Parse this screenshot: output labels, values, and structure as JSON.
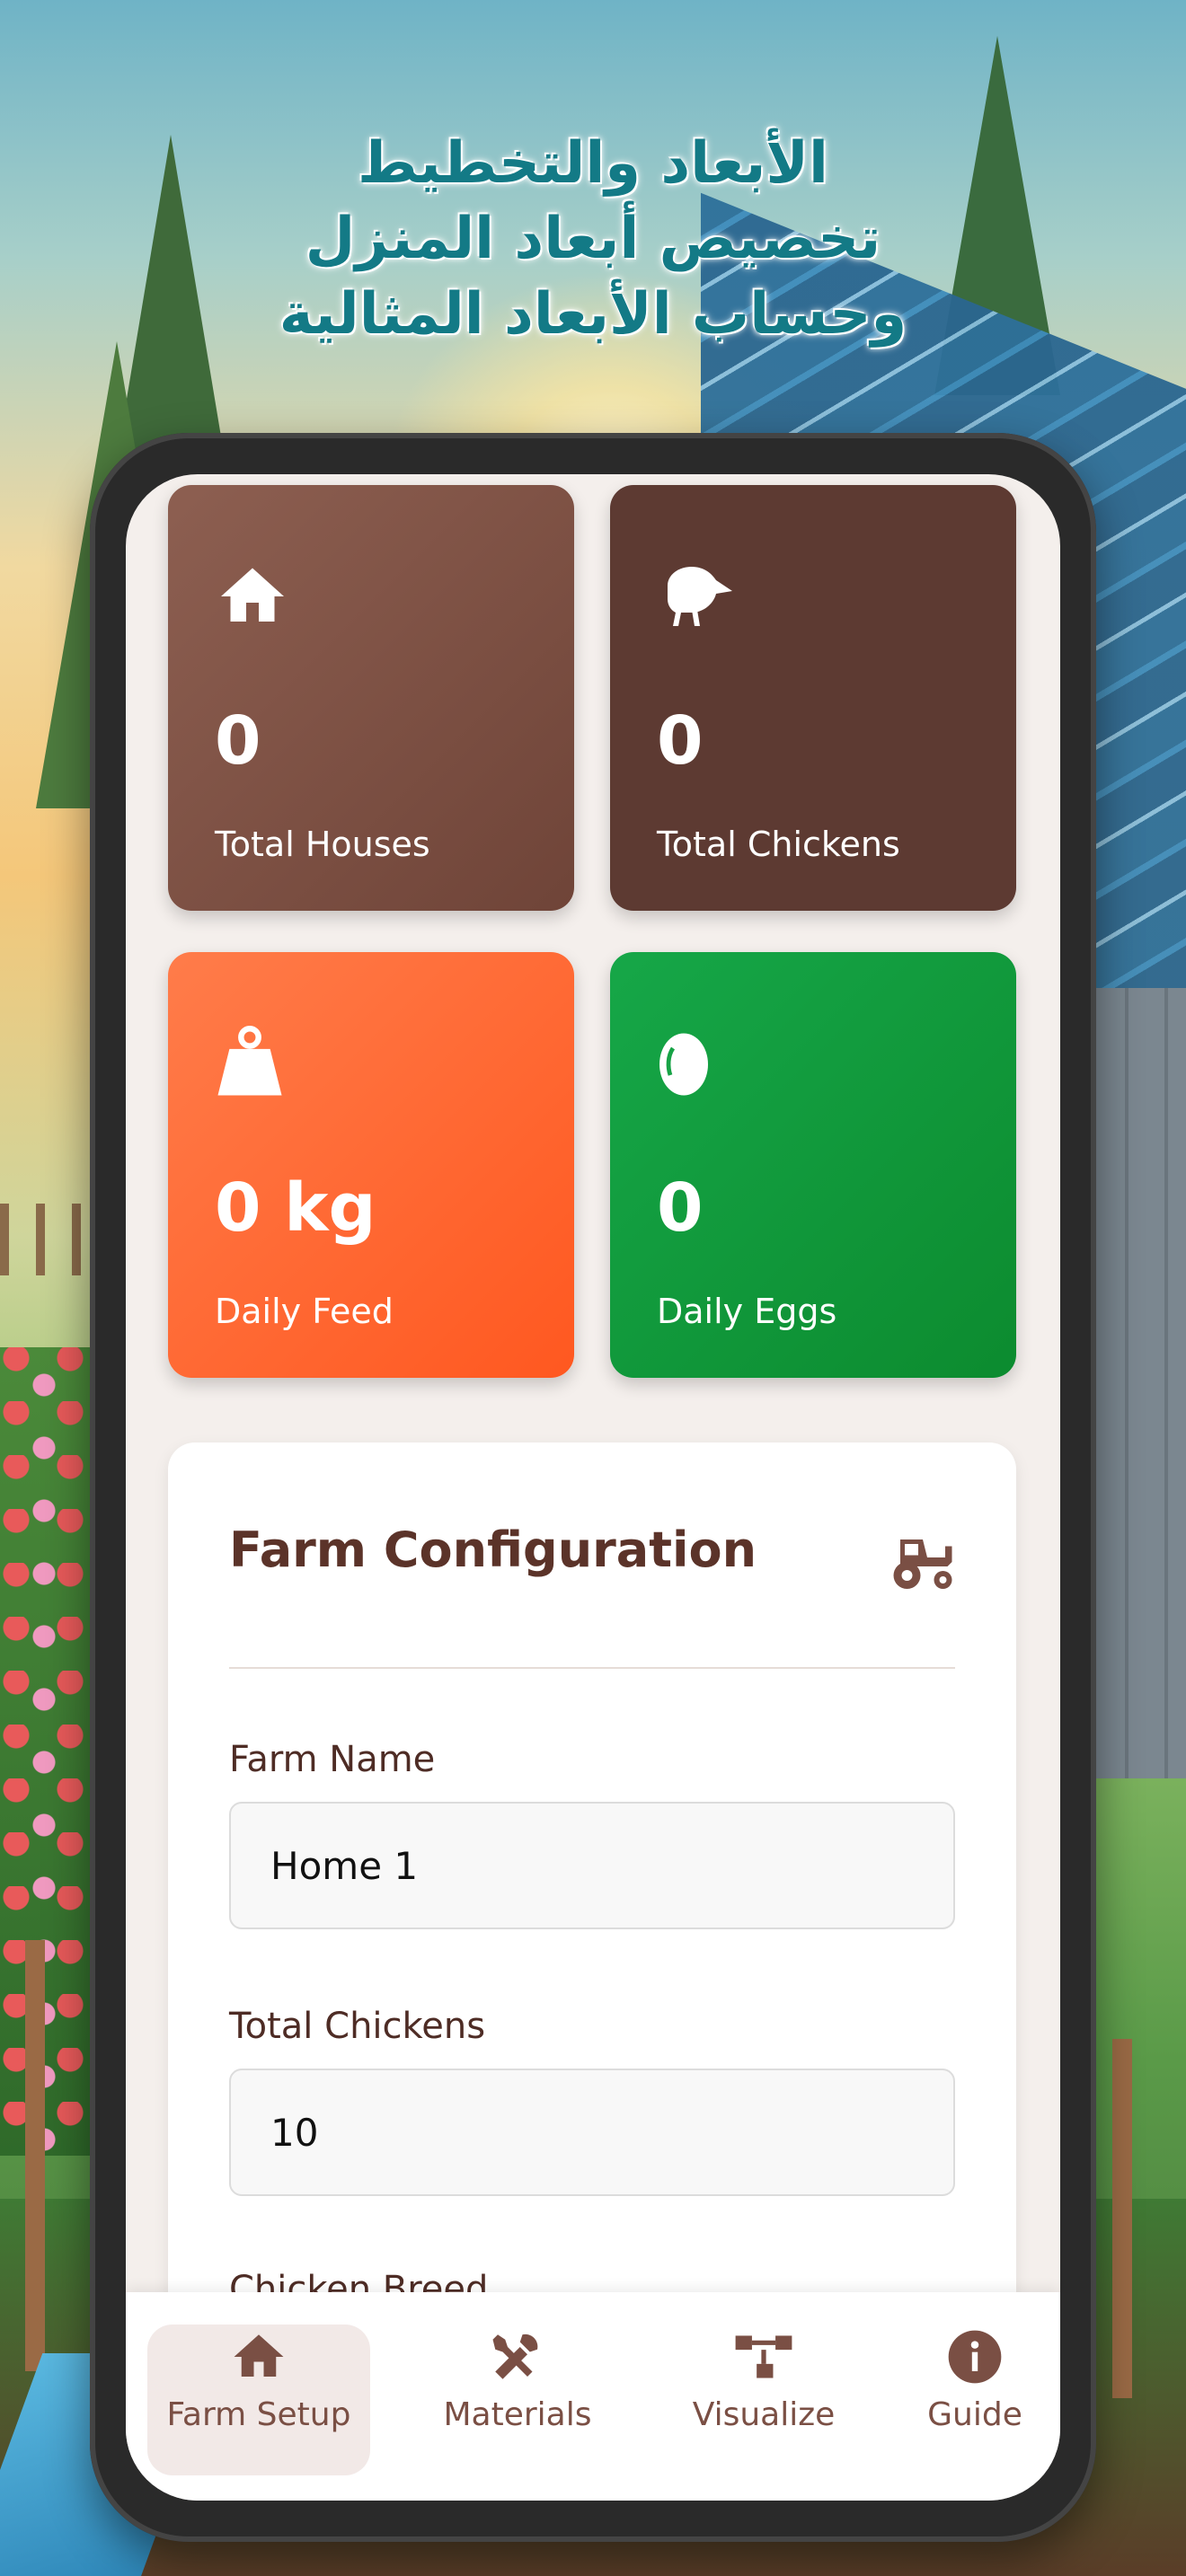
{
  "headline": {
    "lines": [
      "الأبعاد والتخطيط",
      "تخصيص أبعاد المنزل",
      "وحساب الأبعاد المثالية"
    ]
  },
  "stats": [
    {
      "icon": "house-icon",
      "value": "0",
      "label": "Total Houses"
    },
    {
      "icon": "chicken-icon",
      "value": "0",
      "label": "Total Chickens"
    },
    {
      "icon": "weight-icon",
      "value": "0 kg",
      "label": "Daily Feed"
    },
    {
      "icon": "egg-icon",
      "value": "0",
      "label": "Daily Eggs"
    }
  ],
  "config": {
    "title": "Farm Configuration",
    "icon": "tractor-icon",
    "farm_name_label": "Farm Name",
    "farm_name_value": "Home 1",
    "total_chickens_label": "Total Chickens",
    "total_chickens_value": "10",
    "chicken_breed_label": "Chicken Breed"
  },
  "nav": [
    {
      "label": "Farm Setup",
      "icon": "house-icon",
      "active": true
    },
    {
      "label": "Materials",
      "icon": "tools-icon",
      "active": false
    },
    {
      "label": "Visualize",
      "icon": "diagram-icon",
      "active": false
    },
    {
      "label": "Guide",
      "icon": "info-icon",
      "active": false
    }
  ],
  "colors": {
    "brown": "#8d5f51",
    "dark_brown": "#5d3a32",
    "orange": "#ff6a33",
    "green": "#12a03f",
    "title_teal": "#137a86"
  }
}
